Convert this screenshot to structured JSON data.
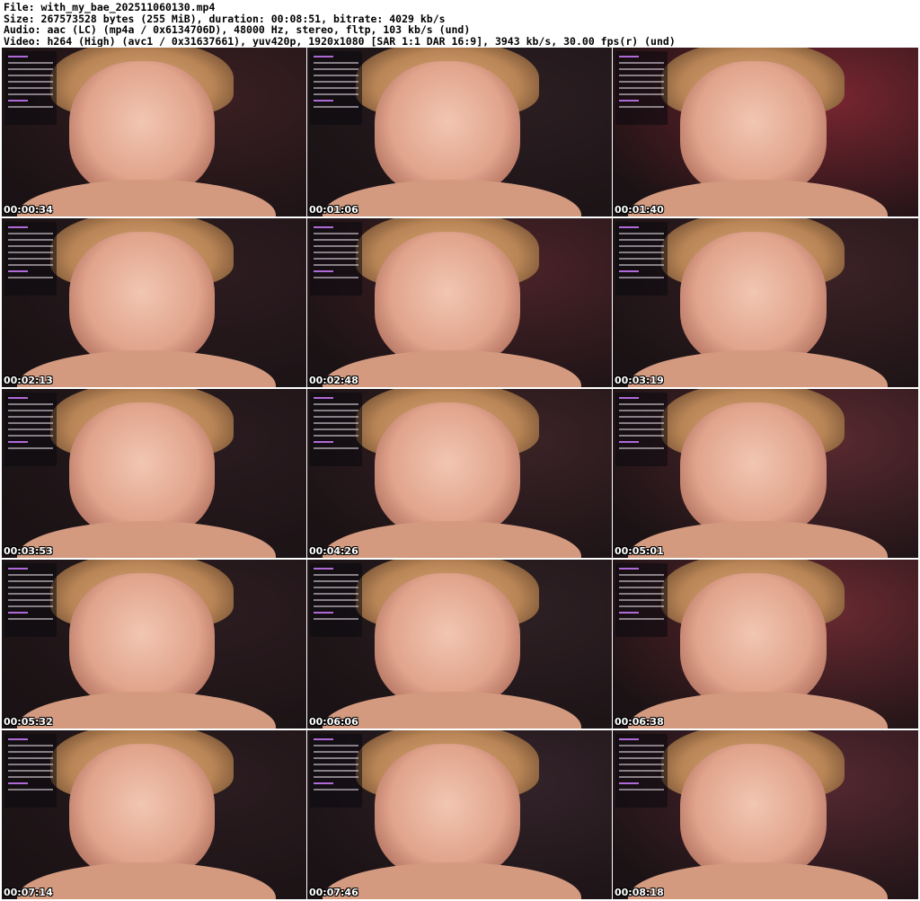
{
  "header": {
    "file": "File: with_my_bae_202511060130.mp4",
    "size": "Size: 267573528 bytes (255 MiB), duration: 00:08:51, bitrate: 4029 kb/s",
    "audio": "Audio: aac (LC) (mp4a / 0x6134706D), 48000 Hz, stereo, fltp, 103 kb/s (und)",
    "video": "Video: h264 (High) (avc1 / 0x31637661), yuv420p, 1920x1080 [SAR 1:1 DAR 16:9], 3943 kb/s, 30.00 fps(r) (und)"
  },
  "thumbnails": [
    {
      "time": "00:00:34",
      "bg": "#3a1f22"
    },
    {
      "time": "00:01:06",
      "bg": "#2b1e22"
    },
    {
      "time": "00:01:40",
      "bg": "#7a2630"
    },
    {
      "time": "00:02:13",
      "bg": "#2d1c20"
    },
    {
      "time": "00:02:48",
      "bg": "#4a2328"
    },
    {
      "time": "00:03:19",
      "bg": "#3c2226"
    },
    {
      "time": "00:03:53",
      "bg": "#2a1b1f"
    },
    {
      "time": "00:04:26",
      "bg": "#3b2326"
    },
    {
      "time": "00:05:01",
      "bg": "#5a2a30"
    },
    {
      "time": "00:05:32",
      "bg": "#2c1c20"
    },
    {
      "time": "00:06:06",
      "bg": "#2e2024"
    },
    {
      "time": "00:06:38",
      "bg": "#6a2a31"
    },
    {
      "time": "00:07:14",
      "bg": "#2b1c20"
    },
    {
      "time": "00:07:46",
      "bg": "#33232a"
    },
    {
      "time": "00:08:18",
      "bg": "#552831"
    }
  ]
}
